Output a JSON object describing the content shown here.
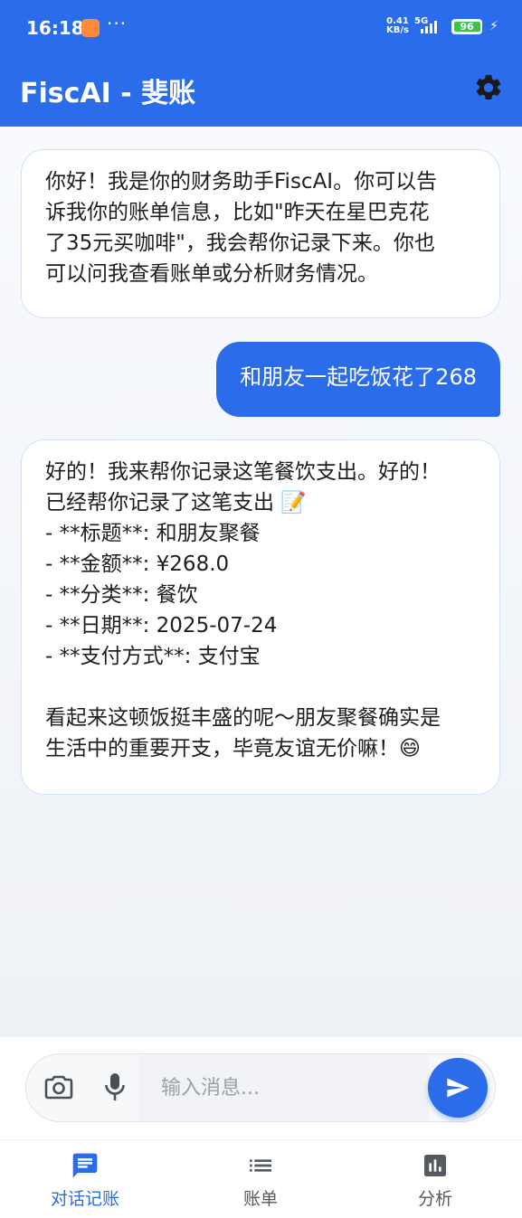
{
  "status_bar": {
    "time": "16:18",
    "more": "···",
    "net_speed_top": "0.41",
    "net_speed_bottom": "KB/s",
    "net_type": "5G",
    "battery": "96"
  },
  "app_bar": {
    "title": "FiscAI - 斐账",
    "settings_icon": "gear-icon"
  },
  "messages": [
    {
      "role": "assistant",
      "lines": [
        "你好！我是你的财务助手FiscAI。你可以告",
        "诉我你的账单信息，比如\"昨天在星巴克花",
        "了35元买咖啡\"，我会帮你记录下来。你也",
        "可以问我查看账单或分析财务情况。"
      ]
    },
    {
      "role": "user",
      "text": "和朋友一起吃饭花了268"
    },
    {
      "role": "assistant",
      "lines": [
        "好的！我来帮你记录这笔餐饮支出。好的！",
        "已经帮你记录了这笔支出 📝",
        "- **标题**: 和朋友聚餐",
        "- **金额**: ¥268.0",
        "- **分类**: 餐饮",
        "- **日期**: 2025-07-24",
        "- **支付方式**: 支付宝",
        "",
        "看起来这顿饭挺丰盛的呢～朋友聚餐确实是",
        "生活中的重要开支，毕竟友谊无价嘛！😄"
      ]
    }
  ],
  "input": {
    "placeholder": "输入消息...",
    "value": ""
  },
  "nav": {
    "items": [
      {
        "label": "对话记账",
        "icon": "chat-icon",
        "active": true
      },
      {
        "label": "账单",
        "icon": "list-icon",
        "active": false
      },
      {
        "label": "分析",
        "icon": "chart-icon",
        "active": false
      }
    ]
  },
  "colors": {
    "primary": "#2a6ce9",
    "inactive": "#555a60"
  }
}
